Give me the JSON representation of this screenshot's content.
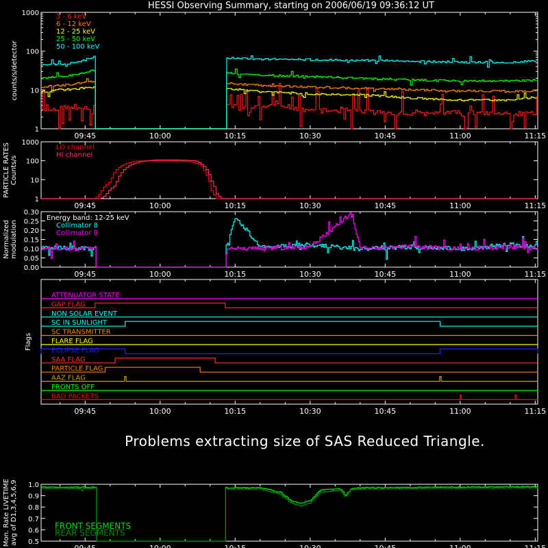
{
  "chart_data": {
    "title": "HESSI Observing Summary, starting on 2006/06/19 09:36:12 UT",
    "message": "Problems extracting size of SAS Reduced Triangle.",
    "time_ticks": [
      "09:45",
      "10:00",
      "10:15",
      "10:30",
      "10:45",
      "11:00",
      "11:15"
    ],
    "time_tick_minutes": [
      45,
      60,
      75,
      90,
      105,
      120,
      135
    ],
    "x_range_minutes": [
      36.2,
      135.5
    ],
    "panels": [
      {
        "id": "count-rates",
        "type": "line",
        "ylabel": "counts/s/detector",
        "scale": "log",
        "ylim": [
          1,
          1000
        ],
        "yticks": [
          "1",
          "10",
          "100",
          "1000"
        ],
        "gap": [
          47.0,
          73.0
        ],
        "series": [
          {
            "name": "3 - 6 keV",
            "color": "#ff1a1a",
            "x": [
              36.2,
              38,
              40,
              44,
              46,
              47,
              73,
              76,
              80,
              84,
              88,
              92,
              98,
              104,
              110,
              120,
              130,
              135.5
            ],
            "y": [
              3.4,
              3.0,
              3.5,
              3.6,
              3.4,
              3.8,
              4.5,
              3.2,
              3.6,
              4.2,
              3.0,
              2.9,
              3.0,
              2.6,
              2.4,
              2.6,
              2.4,
              2.5
            ]
          },
          {
            "name": "6 - 12 keV",
            "color": "#ff8000",
            "x": [
              36.2,
              40,
              44,
              47,
              73,
              80,
              90,
              100,
              110,
              120,
              130,
              135.5
            ],
            "y": [
              12,
              13,
              15,
              17,
              15,
              13,
              12,
              11,
              10,
              9.5,
              9.2,
              9.5
            ]
          },
          {
            "name": "12 - 25 keV",
            "color": "#ffff00",
            "x": [
              36.2,
              40,
              44,
              47,
              73,
              80,
              90,
              100,
              110,
              120,
              130,
              135.5
            ],
            "y": [
              9,
              10,
              11,
              12,
              11,
              9,
              8,
              7.5,
              6.2,
              5.5,
              5.5,
              6.5
            ]
          },
          {
            "name": "25 - 50 keV",
            "color": "#00ff00",
            "x": [
              36.2,
              40,
              44,
              47,
              73,
              80,
              90,
              100,
              110,
              120,
              130,
              135.5
            ],
            "y": [
              20,
              22,
              26,
              33,
              27,
              24,
              22,
              20,
              18,
              17,
              17,
              18
            ]
          },
          {
            "name": "50 - 100 keV",
            "color": "#00ffff",
            "x": [
              36.2,
              40,
              44,
              47,
              73,
              80,
              90,
              100,
              110,
              120,
              130,
              135.5
            ],
            "y": [
              45,
              47,
              52,
              75,
              68,
              62,
              60,
              58,
              55,
              52,
              52,
              56
            ]
          }
        ]
      },
      {
        "id": "particle-rates",
        "type": "line",
        "ylabel": "PARTICLE RATES Counts/s",
        "scale": "log",
        "ylim": [
          1,
          1000
        ],
        "yticks": [
          "1",
          "10",
          "100",
          "1000"
        ],
        "series": [
          {
            "name": "LO channel",
            "color": "#ff0000",
            "x": [
              36.2,
              45,
              47,
              48,
              50,
              51,
              53,
              55,
              58,
              62,
              66,
              68,
              69,
              70,
              71,
              135.5
            ],
            "y": [
              1,
              1,
              1,
              2,
              8,
              30,
              70,
              95,
              100,
              100,
              90,
              60,
              20,
              3,
              1,
              1
            ]
          },
          {
            "name": "HI channel",
            "color": "#ff3060",
            "x": [
              36.2,
              46,
              48,
              49,
              51,
              52,
              54,
              56,
              59,
              63,
              67,
              69,
              70,
              71,
              72,
              135.5
            ],
            "y": [
              1,
              1,
              1,
              1.5,
              5,
              20,
              60,
              90,
              110,
              110,
              100,
              40,
              10,
              2,
              1,
              1
            ]
          }
        ]
      },
      {
        "id": "modulation",
        "type": "line",
        "ylabel": "Normalized modulation",
        "ylim": [
          0,
          0.3
        ],
        "yticks": [
          "0.00",
          "0.05",
          "0.10",
          "0.15",
          "0.20",
          "0.25",
          "0.30"
        ],
        "legend_header": "Energy band: 12-25 keV",
        "gap": [
          47.0,
          73.0
        ],
        "series": [
          {
            "name": "Collimator 8",
            "color": "#00ffff",
            "x": [
              36.2,
              40,
              44,
              47,
              73,
              75,
              80,
              90,
              100,
              110,
              120,
              130,
              135.5
            ],
            "y": [
              0.1,
              0.11,
              0.1,
              0.1,
              0.1,
              0.27,
              0.11,
              0.12,
              0.1,
              0.11,
              0.1,
              0.12,
              0.11
            ]
          },
          {
            "name": "Collimator 9",
            "color": "#ff00ff",
            "x": [
              36.2,
              40,
              44,
              47,
              73,
              80,
              90,
              98,
              100,
              110,
              120,
              130,
              135.5
            ],
            "y": [
              0.1,
              0.1,
              0.1,
              0.1,
              0.1,
              0.1,
              0.11,
              0.29,
              0.1,
              0.11,
              0.1,
              0.11,
              0.1
            ]
          }
        ]
      },
      {
        "id": "flags",
        "type": "line",
        "ylabel": "Flags",
        "series": [
          {
            "name": "ATTENUATOR STATE",
            "color": "#ff00ff",
            "on": []
          },
          {
            "name": "GAP FLAG",
            "color": "#ff2020",
            "on": [
              [
                47.0,
                73.0
              ]
            ]
          },
          {
            "name": "NON SOLAR EVENT",
            "color": "#00ffff",
            "on": []
          },
          {
            "name": "SC IN SUNLIGHT",
            "color": "#00ffff",
            "on": [
              [
                53.0,
                116.0
              ]
            ]
          },
          {
            "name": "SC TRANSMITTER",
            "color": "#ff8000",
            "on": []
          },
          {
            "name": "FLARE FLAG",
            "color": "#ffff00",
            "on": []
          },
          {
            "name": "ECLIPSE FLAG",
            "color": "#2020ff",
            "on": [
              [
                36.2,
                53.0
              ],
              [
                116.0,
                135.5
              ]
            ]
          },
          {
            "name": "SAA FLAG",
            "color": "#ff3030",
            "on": [
              [
                51.0,
                71.0
              ]
            ]
          },
          {
            "name": "PARTICLE FLAG",
            "color": "#ff8000",
            "on": [
              [
                49.0,
                68.0
              ]
            ]
          },
          {
            "name": "AAZ FLAG",
            "color": "#c8a000",
            "on": [
              [
                52.9,
                53.2
              ],
              [
                115.9,
                116.2
              ]
            ]
          },
          {
            "name": "FRONTS OFF",
            "color": "#00ff00",
            "on": []
          },
          {
            "name": "BAD PACKETS",
            "color": "#ff0000",
            "on": [
              [
                120.0,
                120.2
              ],
              [
                131.0,
                131.2
              ]
            ]
          }
        ]
      },
      {
        "id": "livetime",
        "type": "line",
        "ylabel": "Mon. Rate LIVETIME avg of D1,3,4,5,6,9",
        "ylim": [
          0.5,
          1.0
        ],
        "yticks": [
          "0.5",
          "0.6",
          "0.7",
          "0.8",
          "0.9",
          "1.0"
        ],
        "gap": [
          47.0,
          73.0
        ],
        "series": [
          {
            "name": "FRONT SEGMENTS",
            "color": "#00dd00",
            "x": [
              36.2,
              47,
              73,
              80,
              84,
              86,
              88,
              90,
              92,
              96,
              97,
              98,
              100,
              135.5
            ],
            "y": [
              0.975,
              0.975,
              0.97,
              0.97,
              0.93,
              0.86,
              0.83,
              0.86,
              0.95,
              0.96,
              0.9,
              0.96,
              0.97,
              0.98
            ]
          },
          {
            "name": "REAR SEGMENTS",
            "color": "#008800",
            "x": [
              36.2,
              47,
              73,
              80,
              84,
              86,
              88,
              90,
              92,
              96,
              97,
              98,
              100,
              135.5
            ],
            "y": [
              0.965,
              0.965,
              0.96,
              0.96,
              0.91,
              0.84,
              0.81,
              0.84,
              0.93,
              0.95,
              0.89,
              0.95,
              0.96,
              0.97
            ]
          }
        ]
      }
    ]
  }
}
